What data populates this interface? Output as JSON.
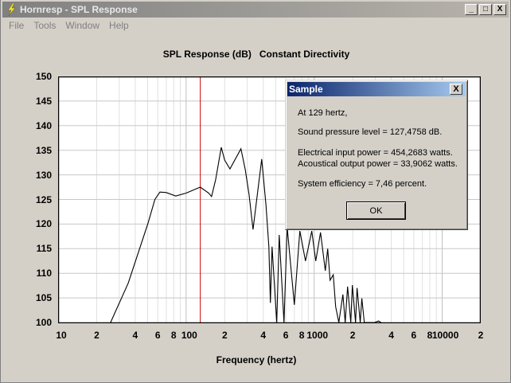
{
  "window": {
    "title": "Hornresp - SPL Response",
    "minimize": "_",
    "maximize": "□",
    "close": "X"
  },
  "menu": [
    "File",
    "Tools",
    "Window",
    "Help"
  ],
  "chart_data": {
    "type": "line",
    "title": "SPL Response (dB)   Constant Directivity",
    "xlabel": "Frequency (hertz)",
    "ylabel": "",
    "xscale": "log",
    "xlim": [
      10,
      20000
    ],
    "ylim": [
      100,
      150
    ],
    "yticks": [
      "150",
      "145",
      "140",
      "135",
      "130",
      "125",
      "120",
      "115",
      "110",
      "105",
      "100"
    ],
    "xtick_labels": [
      {
        "f": 10,
        "t": "10"
      },
      {
        "f": 20,
        "t": "2"
      },
      {
        "f": 40,
        "t": "4"
      },
      {
        "f": 60,
        "t": "6"
      },
      {
        "f": 80,
        "t": "8"
      },
      {
        "f": 100,
        "t": "100"
      },
      {
        "f": 200,
        "t": "2"
      },
      {
        "f": 400,
        "t": "4"
      },
      {
        "f": 600,
        "t": "6"
      },
      {
        "f": 800,
        "t": "8"
      },
      {
        "f": 1000,
        "t": "1000"
      },
      {
        "f": 2000,
        "t": "2"
      },
      {
        "f": 4000,
        "t": "4"
      },
      {
        "f": 6000,
        "t": "6"
      },
      {
        "f": 8000,
        "t": "8"
      },
      {
        "f": 10000,
        "t": "10000"
      },
      {
        "f": 20000,
        "t": "2"
      }
    ],
    "grid": true,
    "marker_frequency": 129,
    "marker_color": "#cc0000",
    "series": [
      {
        "name": "SPL",
        "color": "#000000",
        "points": [
          [
            25.7,
            100
          ],
          [
            35.3,
            108
          ],
          [
            50.4,
            120.2
          ],
          [
            57,
            125
          ],
          [
            62.4,
            126.5
          ],
          [
            70,
            126.4
          ],
          [
            83,
            125.7
          ],
          [
            100,
            126.3
          ],
          [
            129,
            127.5
          ],
          [
            150,
            126.3
          ],
          [
            158,
            125.6
          ],
          [
            170,
            129
          ],
          [
            188,
            135.6
          ],
          [
            200,
            133
          ],
          [
            220,
            131.2
          ],
          [
            268,
            135.3
          ],
          [
            290,
            131
          ],
          [
            310,
            126
          ],
          [
            333,
            118.9
          ],
          [
            360,
            126
          ],
          [
            389,
            133.2
          ],
          [
            420,
            124
          ],
          [
            443,
            115.4
          ],
          [
            455,
            104
          ],
          [
            469,
            115.4
          ],
          [
            510,
            100
          ],
          [
            533,
            117.8
          ],
          [
            581,
            100
          ],
          [
            615,
            119.4
          ],
          [
            700,
            103.6
          ],
          [
            773,
            118.6
          ],
          [
            855,
            112.5
          ],
          [
            958,
            118.6
          ],
          [
            1029,
            112.5
          ],
          [
            1121,
            118.3
          ],
          [
            1222,
            110.5
          ],
          [
            1276,
            115
          ],
          [
            1332,
            108.6
          ],
          [
            1410,
            109.7
          ],
          [
            1472,
            103.2
          ],
          [
            1559,
            100
          ],
          [
            1675,
            105.7
          ],
          [
            1747,
            100
          ],
          [
            1824,
            107.3
          ],
          [
            1931,
            100
          ],
          [
            1987,
            107.6
          ],
          [
            2104,
            100
          ],
          [
            2163,
            107
          ],
          [
            2291,
            100
          ],
          [
            2358,
            104.9
          ],
          [
            2462,
            100
          ],
          [
            2965,
            100
          ],
          [
            3184,
            100.3
          ],
          [
            3327,
            100
          ]
        ]
      }
    ]
  },
  "dialog": {
    "title": "Sample",
    "close": "X",
    "line1": "At 129 hertz,",
    "line2": "Sound pressure level = 127,4758 dB.",
    "line3": "Electrical input power = 454,2683 watts.",
    "line4": "Acoustical output power = 33,9062 watts.",
    "line5": "System efficiency = 7,46 percent.",
    "ok": "OK"
  }
}
